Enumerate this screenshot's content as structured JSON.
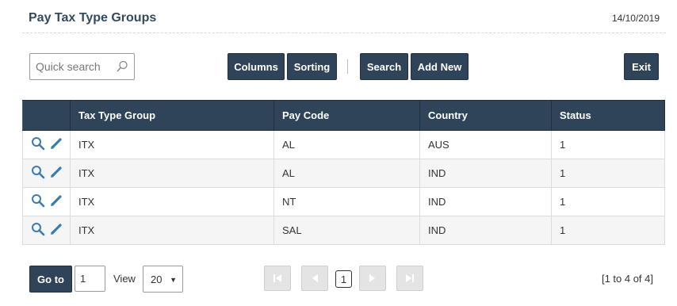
{
  "header": {
    "title": "Pay Tax Type Groups",
    "date": "14/10/2019"
  },
  "toolbar": {
    "search_placeholder": "Quick search",
    "columns_label": "Columns",
    "sorting_label": "Sorting",
    "search_label": "Search",
    "add_new_label": "Add New",
    "exit_label": "Exit"
  },
  "table": {
    "columns": [
      "Tax Type Group",
      "Pay Code",
      "Country",
      "Status"
    ],
    "rows": [
      {
        "group": "ITX",
        "pay_code": "AL",
        "country": "AUS",
        "status": "1"
      },
      {
        "group": "ITX",
        "pay_code": "AL",
        "country": "IND",
        "status": "1"
      },
      {
        "group": "ITX",
        "pay_code": "NT",
        "country": "IND",
        "status": "1"
      },
      {
        "group": "ITX",
        "pay_code": "SAL",
        "country": "IND",
        "status": "1"
      }
    ]
  },
  "pagination": {
    "goto_label": "Go to",
    "page_value": "1",
    "view_label": "View",
    "page_size": "20",
    "current_page": "1",
    "range_text": "[1 to 4 of 4]"
  },
  "colors": {
    "primary": "#2f4458",
    "icon": "#3a7bb0"
  },
  "icons": [
    "search-icon",
    "view-icon",
    "edit-icon",
    "first-page-icon",
    "prev-page-icon",
    "next-page-icon",
    "last-page-icon",
    "caret-down-icon"
  ]
}
